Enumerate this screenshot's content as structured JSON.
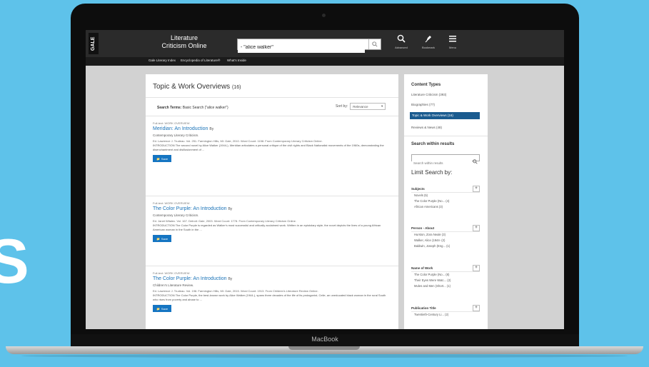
{
  "background_letter": "S",
  "device": {
    "chin_label": "MacBook"
  },
  "colors": {
    "background": "#5ec2ea",
    "accent": "#1575c2",
    "active_facet": "#1a5b8f"
  },
  "header": {
    "logo": "GALE",
    "product_title": "Literature Criticism Online",
    "search_value": "- \"alice walker\"",
    "tools": [
      {
        "icon": "magnifier-icon",
        "caption": "Advanced"
      },
      {
        "icon": "pin-icon",
        "caption": "Bookmark"
      },
      {
        "icon": "menu-icon",
        "caption": "Menu"
      }
    ]
  },
  "subnav": [
    "Gale Literary Index",
    "Encyclopedia of Literature®",
    "What's Inside"
  ],
  "results": {
    "title": "Topic & Work Overviews",
    "count": "(16)",
    "search_terms_label": "Search Terms:",
    "search_terms_value": "Basic Search (\"alice walker\")",
    "sort_label": "Sort by:",
    "sort_value": "Relevance",
    "save_label": "Save",
    "items": [
      {
        "type": "Full-text: WORK OVERVIEW",
        "title": "Meridian: An Introduction",
        "by": "By",
        "source": "Contemporary Literary Criticism.",
        "citation": "Ed. Lawrence J. Trudeau. Vol. 251. Farmington Hills, MI: Gale, 2010. Word Count: 1158. From Contemporary Literary Criticism Online.",
        "snippet": "INTRODUCTION The second novel by Alice Walker (1944-), Meridian articulates a personal critique of the civil rights and Black Nationalist movements of the 1960s, demonstrating the disenchantment and disillusionment of ..."
      },
      {
        "type": "Full-text: WORK OVERVIEW",
        "title": "The Color Purple: An Introduction",
        "by": "By",
        "source": "Contemporary Literary Criticism.",
        "citation": "Ed. Janet Witalec. Vol. 167. Detroit: Gale, 2003. Word Count: 1778. From Contemporary Literary Criticism Online.",
        "snippet": "INTRODUCTION The Color Purple is regarded as Walker's most successful and critically acclaimed work. Written in an epistolary style, the novel depicts the lives of a young African American woman in the South in the ..."
      },
      {
        "type": "Full-text: WORK OVERVIEW",
        "title": "The Color Purple: An Introduction",
        "by": "By",
        "source": "Children's Literature Review.",
        "citation": "Ed. Lawrence J. Trudeau. Vol. 198. Farmington Hills, MI: Gale, 2015. Word Count: 1913. From Children's Literature Review Online.",
        "snippet": "INTRODUCTION The Color Purple, the best-known work by Alice Walker (1944-), spans three decades of the life of its protagonist, Celie, an uneducated black woman in the rural South who rises from poverty and abuse to ..."
      }
    ]
  },
  "sidebar": {
    "content_types_heading": "Content Types",
    "content_types": [
      {
        "label": "Literature Criticism (393)",
        "active": false
      },
      {
        "label": "Biographies (77)",
        "active": false
      },
      {
        "label": "Topic & Work Overviews (16)",
        "active": true
      },
      {
        "label": "Reviews & News (48)",
        "active": false
      }
    ],
    "search_within_heading": "Search within results",
    "search_within_placeholder": "Search within results",
    "limit_heading": "Limit Search by:",
    "facets": [
      {
        "name": "Subjects",
        "toggle": "+",
        "items": [
          "Novels (5)",
          "The Color Purple (No... (4)",
          "African Americans (3)"
        ]
      },
      {
        "name": "Person - About",
        "toggle": "+",
        "items": [
          "Hurston, Zora Neale (3)",
          "Walker, Alice (1944- (2)",
          "Baldwin, Joseph (Eng... (1)"
        ]
      },
      {
        "name": "Name of Work",
        "toggle": "+",
        "items": [
          "The Color Purple (No... (8)",
          "Their Eyes Were Watc... (2)",
          "Mules and Men (Short... (1)"
        ]
      },
      {
        "name": "Publication Title",
        "toggle": "+",
        "items": [
          "Twentieth-Century Li... (2)"
        ]
      }
    ]
  }
}
